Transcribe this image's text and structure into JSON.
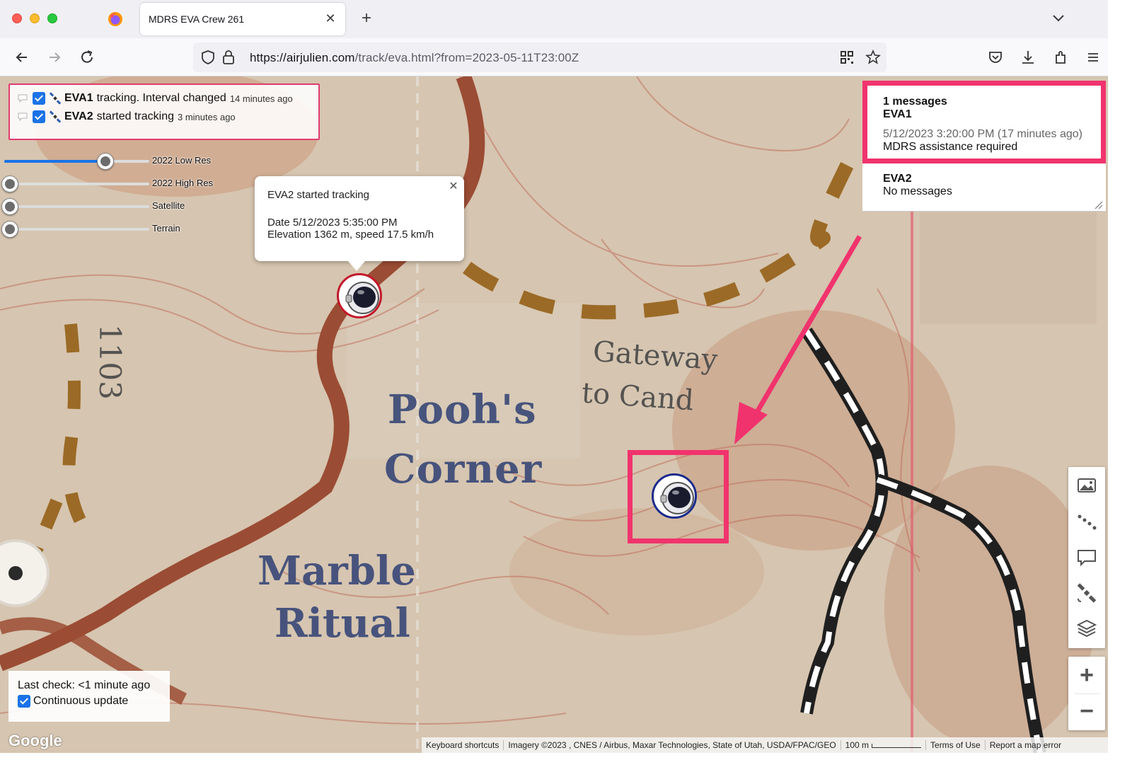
{
  "browser": {
    "tab_title": "MDRS EVA Crew 261",
    "url_host": "https://airjulien.com",
    "url_rest": "/track/eva.html?from=2023-05-11T23:00Z",
    "tab_close": "✕",
    "new_tab": "+"
  },
  "layers": {
    "rows": [
      {
        "name": "EVA1",
        "text": "tracking. Interval changed",
        "ago": "14 minutes ago"
      },
      {
        "name": "EVA2",
        "text": "started tracking",
        "ago": "3 minutes ago"
      }
    ]
  },
  "sliders": [
    {
      "label": "2022 Low Res",
      "value": 0.66
    },
    {
      "label": "2022 High Res",
      "value": 0
    },
    {
      "label": "Satellite",
      "value": 0
    },
    {
      "label": "Terrain",
      "value": 0
    }
  ],
  "info_window": {
    "title": "EVA2 started tracking",
    "date": "Date 5/12/2023 5:35:00 PM",
    "elevation": "Elevation 1362 m, speed 17.5 km/h",
    "close": "✕"
  },
  "map_labels": {
    "pooh": "Pooh's",
    "corner": "Corner",
    "marble": "Marble",
    "ritual": "Ritual",
    "gateway": "Gateway",
    "tocandy": "to Cand",
    "road": "1103"
  },
  "messages": {
    "eva1_count": "1 messages",
    "eva1_name": "EVA1",
    "eva1_time": "5/12/2023 3:20:00 PM (17 minutes ago)",
    "eva1_text": "MDRS assistance required",
    "eva2_name": "EVA2",
    "eva2_text": "No messages"
  },
  "zoom": {
    "in": "+",
    "out": "−"
  },
  "status": {
    "last_check": "Last check: <1 minute ago",
    "continuous": "Continuous update"
  },
  "footer": {
    "google": "Google",
    "shortcuts": "Keyboard shortcuts",
    "imagery": "Imagery ©2023 , CNES / Airbus, Maxar Technologies, State of Utah, USDA/FPAC/GEO",
    "scale": "100 m",
    "terms": "Terms of Use",
    "report": "Report a map error"
  },
  "colors": {
    "highlight": "#f1336d",
    "eva1_marker": "#1a2b8c",
    "eva2_marker": "#c4182a",
    "checkbox": "#1a73e8"
  },
  "icons": {
    "firefox": "firefox-icon",
    "back": "arrow-left-icon",
    "forward": "arrow-right-icon",
    "reload": "reload-icon",
    "shield": "shield-icon",
    "lock": "lock-icon",
    "qr": "qr-code-icon",
    "star": "star-icon",
    "pocket": "pocket-icon",
    "download": "download-icon",
    "extensions": "puzzle-icon",
    "menu": "hamburger-menu-icon",
    "astronaut": "astronaut-helmet-icon"
  }
}
